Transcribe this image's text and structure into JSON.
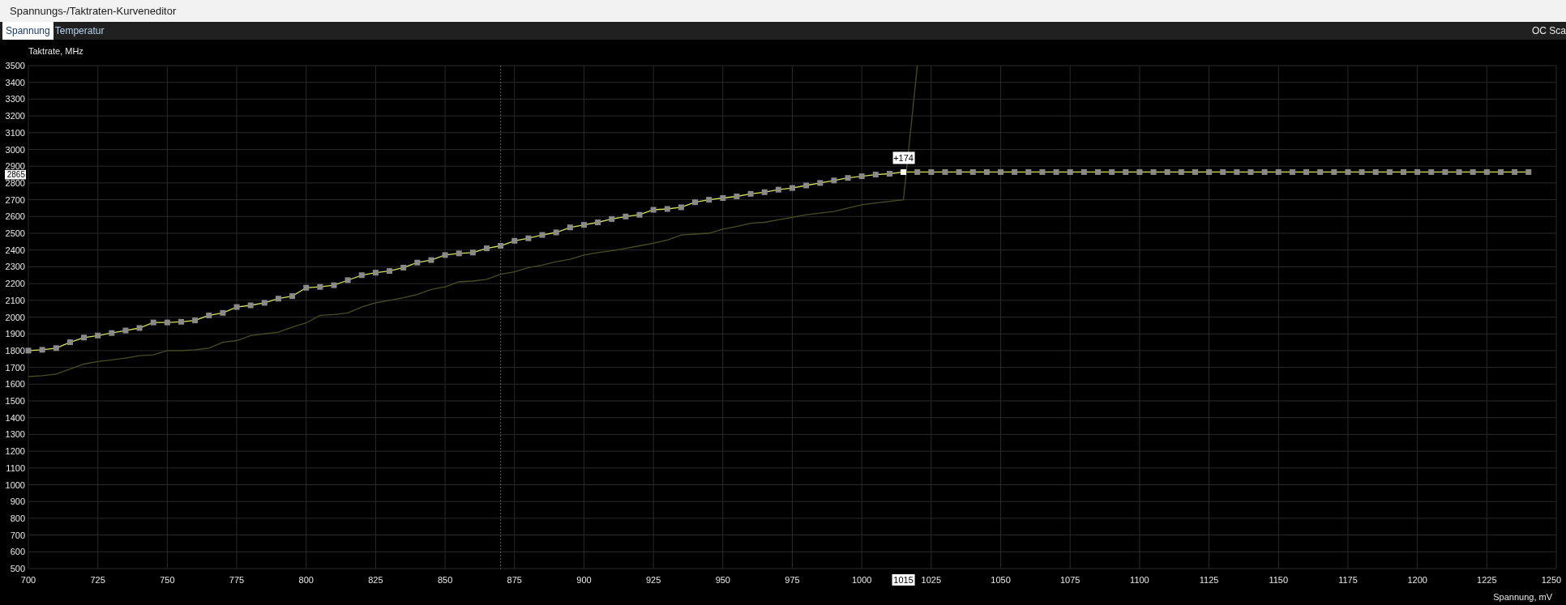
{
  "window": {
    "title": "Spannungs-/Taktraten-Kurveneditor"
  },
  "tabs": [
    {
      "label": "Spannung",
      "selected": true
    },
    {
      "label": "Temperatur",
      "selected": false
    }
  ],
  "oc_scan_button": {
    "label": "OC Sca"
  },
  "chart_data": {
    "type": "line",
    "xlabel": "Spannung, mV",
    "ylabel": "Taktrate, MHz",
    "x": [
      700,
      705,
      710,
      715,
      720,
      725,
      730,
      735,
      740,
      745,
      750,
      755,
      760,
      765,
      770,
      775,
      780,
      785,
      790,
      795,
      800,
      805,
      810,
      815,
      820,
      825,
      830,
      835,
      840,
      845,
      850,
      855,
      860,
      865,
      870,
      875,
      880,
      885,
      890,
      895,
      900,
      905,
      910,
      915,
      920,
      925,
      930,
      935,
      940,
      945,
      950,
      955,
      960,
      965,
      970,
      975,
      980,
      985,
      990,
      995,
      1000,
      1005,
      1010,
      1015,
      1020,
      1025,
      1030,
      1035,
      1040,
      1045,
      1050,
      1055,
      1060,
      1065,
      1070,
      1075,
      1080,
      1085,
      1090,
      1095,
      1100,
      1105,
      1110,
      1115,
      1120,
      1125,
      1130,
      1135,
      1140,
      1145,
      1150,
      1155,
      1160,
      1165,
      1170,
      1175,
      1180,
      1185,
      1190,
      1195,
      1200,
      1205,
      1210,
      1215,
      1220,
      1225,
      1230,
      1235,
      1240
    ],
    "series": [
      {
        "color": "#d7e25a",
        "marker": "square",
        "values": [
          1800,
          1805,
          1815,
          1850,
          1878,
          1890,
          1905,
          1920,
          1935,
          1968,
          1968,
          1972,
          1980,
          2010,
          2025,
          2060,
          2070,
          2085,
          2110,
          2125,
          2175,
          2180,
          2190,
          2220,
          2250,
          2265,
          2275,
          2295,
          2325,
          2340,
          2370,
          2380,
          2385,
          2410,
          2425,
          2455,
          2470,
          2490,
          2505,
          2535,
          2550,
          2565,
          2585,
          2600,
          2610,
          2640,
          2645,
          2655,
          2685,
          2700,
          2710,
          2720,
          2735,
          2745,
          2760,
          2770,
          2785,
          2800,
          2815,
          2830,
          2840,
          2850,
          2855,
          2865,
          2865,
          2865,
          2865,
          2865,
          2865,
          2865,
          2865,
          2865,
          2865,
          2865,
          2865,
          2865,
          2865,
          2865,
          2865,
          2865,
          2865,
          2865,
          2865,
          2865,
          2865,
          2865,
          2865,
          2865,
          2865,
          2865,
          2865,
          2865,
          2865,
          2865,
          2865,
          2865,
          2865,
          2865,
          2865,
          2865,
          2865,
          2865,
          2865,
          2865,
          2865,
          2865,
          2865,
          2865,
          2865
        ]
      },
      {
        "color": "#4a4d22",
        "values": [
          1645,
          1650,
          1660,
          1690,
          1720,
          1735,
          1745,
          1755,
          1770,
          1775,
          1800,
          1800,
          1805,
          1815,
          1850,
          1860,
          1890,
          1900,
          1910,
          1940,
          1965,
          2010,
          2015,
          2025,
          2060,
          2085,
          2100,
          2115,
          2135,
          2165,
          2180,
          2210,
          2215,
          2225,
          2255,
          2270,
          2295,
          2310,
          2330,
          2345,
          2370,
          2385,
          2395,
          2410,
          2425,
          2440,
          2460,
          2490,
          2495,
          2500,
          2525,
          2540,
          2560,
          2565,
          2580,
          2595,
          2610,
          2620,
          2630,
          2650,
          2670,
          2680,
          2690,
          2700,
          3500,
          null,
          null,
          null,
          null,
          null,
          null,
          null,
          null,
          null,
          null,
          null,
          null,
          null,
          null,
          null,
          null,
          null,
          null,
          null,
          null,
          null,
          null,
          null,
          null,
          null,
          null,
          null,
          null,
          null,
          null,
          null,
          null,
          null,
          null,
          null,
          null,
          null,
          null,
          null,
          null,
          null,
          null,
          null,
          null
        ]
      }
    ],
    "xlim": [
      700,
      1250
    ],
    "ylim": [
      500,
      3500
    ],
    "xticks": [
      700,
      725,
      750,
      775,
      800,
      825,
      850,
      875,
      900,
      925,
      950,
      975,
      1000,
      1025,
      1050,
      1075,
      1100,
      1125,
      1150,
      1175,
      1200,
      1225,
      1250
    ],
    "yticks": [
      500,
      600,
      700,
      800,
      900,
      1000,
      1100,
      1200,
      1300,
      1400,
      1500,
      1600,
      1700,
      1800,
      1900,
      2000,
      2100,
      2200,
      2300,
      2400,
      2500,
      2600,
      2700,
      2800,
      2900,
      3000,
      3100,
      3200,
      3300,
      3400,
      3500
    ],
    "grid": true,
    "ref_lines": [
      {
        "axis": "x",
        "value": 870
      }
    ],
    "annotations": [
      {
        "x": 1015,
        "y": 2865,
        "text": "+174"
      }
    ]
  },
  "cursor": {
    "y_label": "2865",
    "x_label": "1015"
  }
}
